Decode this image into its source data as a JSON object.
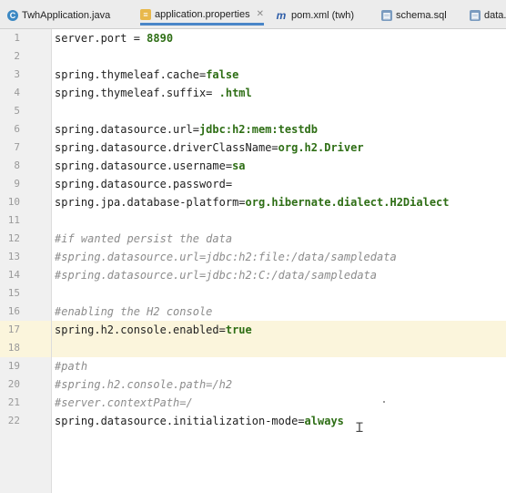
{
  "tabs": [
    {
      "label": "TwhApplication.java",
      "icon": "java-class-icon"
    },
    {
      "label": "application.properties",
      "icon": "properties-file-icon",
      "active": true
    },
    {
      "label": "pom.xml (twh)",
      "icon": "maven-icon"
    },
    {
      "label": "schema.sql",
      "icon": "sql-file-icon"
    },
    {
      "label": "data.",
      "icon": "sql-file-icon"
    }
  ],
  "lines": [
    {
      "num": "1",
      "key": "server.port",
      "eq": " = ",
      "val": "8890"
    },
    {
      "num": "2"
    },
    {
      "num": "3",
      "key": "spring.thymeleaf.cache",
      "eq": "=",
      "val": "false"
    },
    {
      "num": "4",
      "key": "spring.thymeleaf.suffix",
      "eq": "= ",
      "val": ".html"
    },
    {
      "num": "5"
    },
    {
      "num": "6",
      "key": "spring.datasource.url",
      "eq": "=",
      "val": "jdbc:h2:mem:testdb"
    },
    {
      "num": "7",
      "key": "spring.datasource.driverClassName",
      "eq": "=",
      "val": "org.h2.Driver"
    },
    {
      "num": "8",
      "key": "spring.datasource.username",
      "eq": "=",
      "val": "sa"
    },
    {
      "num": "9",
      "key": "spring.datasource.password",
      "eq": "=",
      "val": ""
    },
    {
      "num": "10",
      "key": "spring.jpa.database-platform",
      "eq": "=",
      "val": "org.hibernate.dialect.H2Dialect"
    },
    {
      "num": "11"
    },
    {
      "num": "12",
      "comment": "#if wanted persist the data"
    },
    {
      "num": "13",
      "comment": "#spring.datasource.url=jdbc:h2:file:/data/sampledata"
    },
    {
      "num": "14",
      "comment": "#spring.datasource.url=jdbc:h2:C:/data/sampledata"
    },
    {
      "num": "15"
    },
    {
      "num": "16",
      "comment": "#enabling the H2 console"
    },
    {
      "num": "17",
      "key": "spring.h2.console.enabled",
      "eq": "=",
      "val": "true",
      "highlight": true
    },
    {
      "num": "18",
      "highlight": true
    },
    {
      "num": "19",
      "comment": "#path"
    },
    {
      "num": "20",
      "comment": "#spring.h2.console.path=/h2"
    },
    {
      "num": "21",
      "comment": "#server.contextPath=/"
    },
    {
      "num": "22",
      "key": "spring.datasource.initialization-mode",
      "eq": "=",
      "val": "always"
    }
  ]
}
